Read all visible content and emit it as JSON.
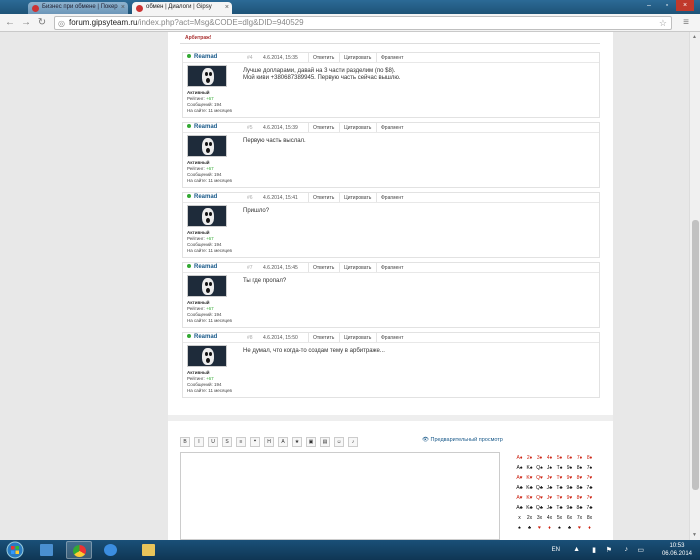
{
  "browser": {
    "tabs": [
      {
        "title": "Бизнес при обмене | Покер"
      },
      {
        "title": "обмен | Диалоги | Gipsy"
      }
    ],
    "url_host": "forum.gipsyteam.ru",
    "url_path": "/index.php?act=Msg&CODE=dlg&DID=940529"
  },
  "top_strip": {
    "label": "Арбитраж!"
  },
  "post_actions": {
    "reply": "Ответить",
    "quote": "Цитировать",
    "fragment": "Фрагмент"
  },
  "posts": [
    {
      "user": "Reamad",
      "num": "#4",
      "date": "4.6.2014, 15:35",
      "status": "Активный",
      "rating_label": "Рейтинг:",
      "rating": "+67",
      "messages": "Сообщений: 194",
      "site": "На сайте: 11 месяцев",
      "text": "Лучше долларами, давай на 3 части разделим (по $8).\nМой киви +380687389945. Первую часть сейчас вышлю."
    },
    {
      "user": "Reamad",
      "num": "#5",
      "date": "4.6.2014, 15:39",
      "status": "Активный",
      "rating_label": "Рейтинг:",
      "rating": "+67",
      "messages": "Сообщений: 194",
      "site": "На сайте: 11 месяцев",
      "text": "Первую часть выслал."
    },
    {
      "user": "Reamad",
      "num": "#6",
      "date": "4.6.2014, 15:41",
      "status": "Активный",
      "rating_label": "Рейтинг:",
      "rating": "+67",
      "messages": "Сообщений: 194",
      "site": "На сайте: 11 месяцев",
      "text": "Пришло?"
    },
    {
      "user": "Reamad",
      "num": "#7",
      "date": "4.6.2014, 15:45",
      "status": "Активный",
      "rating_label": "Рейтинг:",
      "rating": "+67",
      "messages": "Сообщений: 194",
      "site": "На сайте: 11 месяцев",
      "text": "Ты где пропал?"
    },
    {
      "user": "Reamad",
      "num": "#8",
      "date": "4.6.2014, 15:50",
      "status": "Активный",
      "rating_label": "Рейтинг:",
      "rating": "+67",
      "messages": "Сообщений: 194",
      "site": "На сайте: 11 месяцев",
      "text": "Не думал, что когда-то создам тему в арбитраже..."
    }
  ],
  "editor": {
    "toolbar": [
      "B",
      "I",
      "U",
      "S",
      "≡",
      "❝",
      "H",
      "A",
      "★",
      "▣",
      "▤",
      "☺",
      "♪"
    ],
    "preview_label": "Предварительный просмотр",
    "cards": [
      {
        "t": "A♦",
        "red": true
      },
      {
        "t": "2♦",
        "red": true
      },
      {
        "t": "3♦",
        "red": true
      },
      {
        "t": "4♦",
        "red": true
      },
      {
        "t": "5♦",
        "red": true
      },
      {
        "t": "6♦",
        "red": true
      },
      {
        "t": "7♦",
        "red": true
      },
      {
        "t": "8♦",
        "red": true
      },
      {
        "t": "A♠",
        "red": false
      },
      {
        "t": "K♠",
        "red": false
      },
      {
        "t": "Q♠",
        "red": false
      },
      {
        "t": "J♠",
        "red": false
      },
      {
        "t": "T♠",
        "red": false
      },
      {
        "t": "9♠",
        "red": false
      },
      {
        "t": "8♠",
        "red": false
      },
      {
        "t": "7♠",
        "red": false
      },
      {
        "t": "A♥",
        "red": true
      },
      {
        "t": "K♥",
        "red": true
      },
      {
        "t": "Q♥",
        "red": true
      },
      {
        "t": "J♥",
        "red": true
      },
      {
        "t": "T♥",
        "red": true
      },
      {
        "t": "9♥",
        "red": true
      },
      {
        "t": "8♥",
        "red": true
      },
      {
        "t": "7♥",
        "red": true
      },
      {
        "t": "A♣",
        "red": false
      },
      {
        "t": "K♣",
        "red": false
      },
      {
        "t": "Q♣",
        "red": false
      },
      {
        "t": "J♣",
        "red": false
      },
      {
        "t": "T♣",
        "red": false
      },
      {
        "t": "9♣",
        "red": false
      },
      {
        "t": "8♣",
        "red": false
      },
      {
        "t": "7♣",
        "red": false
      },
      {
        "t": "A♥",
        "red": true
      },
      {
        "t": "K♥",
        "red": true
      },
      {
        "t": "Q♥",
        "red": true
      },
      {
        "t": "J♥",
        "red": true
      },
      {
        "t": "T♥",
        "red": true
      },
      {
        "t": "9♥",
        "red": true
      },
      {
        "t": "8♥",
        "red": true
      },
      {
        "t": "7♥",
        "red": true
      },
      {
        "t": "A♣",
        "red": false
      },
      {
        "t": "K♣",
        "red": false
      },
      {
        "t": "Q♣",
        "red": false
      },
      {
        "t": "J♣",
        "red": false
      },
      {
        "t": "T♣",
        "red": false
      },
      {
        "t": "9♣",
        "red": false
      },
      {
        "t": "8♣",
        "red": false
      },
      {
        "t": "7♣",
        "red": false
      },
      {
        "t": "x",
        "red": false
      },
      {
        "t": "2x",
        "red": false
      },
      {
        "t": "3x",
        "red": false
      },
      {
        "t": "4x",
        "red": false
      },
      {
        "t": "5x",
        "red": false
      },
      {
        "t": "6x",
        "red": false
      },
      {
        "t": "7x",
        "red": false
      },
      {
        "t": "8x",
        "red": false
      },
      {
        "t": "♠",
        "red": false
      },
      {
        "t": "♣",
        "red": false
      },
      {
        "t": "♥",
        "red": true
      },
      {
        "t": "♦",
        "red": true
      },
      {
        "t": "♠",
        "red": false
      },
      {
        "t": "♣",
        "red": false
      },
      {
        "t": "♥",
        "red": true
      },
      {
        "t": "♦",
        "red": true
      }
    ]
  },
  "taskbar": {
    "lang": "EN",
    "time": "10:53",
    "date": "06.06.2014"
  }
}
